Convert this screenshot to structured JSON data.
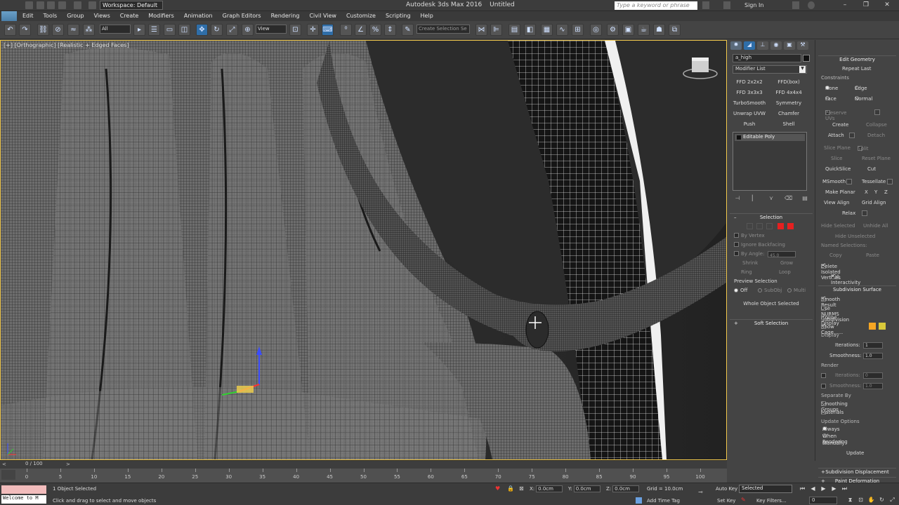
{
  "titlebar": {
    "workspace": "Workspace: Default",
    "app_name": "Autodesk 3ds Max 2016",
    "file_name": "Untitled",
    "search_placeholder": "Type a keyword or phrase",
    "sign_in": "Sign In"
  },
  "logo": "MAX",
  "menus": [
    "Edit",
    "Tools",
    "Group",
    "Views",
    "Create",
    "Modifiers",
    "Animation",
    "Graph Editors",
    "Rendering",
    "Civil View",
    "Customize",
    "Scripting",
    "Help"
  ],
  "toolbar": {
    "filter_value": "All",
    "ref_coord": "View",
    "named_selection_placeholder": "Create Selection Se"
  },
  "viewport": {
    "label_plus": "[+]",
    "label_view": "[Orthographic]",
    "label_shading": "[Realistic + Edged Faces]"
  },
  "command_panel": {
    "object_name": "a_high",
    "modifier_list": "Modifier List",
    "modifier_buttons": [
      "FFD 2x2x2",
      "FFD(box)",
      "FFD 3x3x3",
      "FFD 4x4x4",
      "TurboSmooth",
      "Symmetry",
      "Unwrap UVW",
      "Chamfer",
      "Push",
      "Shell"
    ],
    "stack_item": "Editable Poly",
    "selection": {
      "title": "Selection",
      "by_vertex": "By Vertex",
      "ignore_backfacing": "Ignore Backfacing",
      "by_angle": "By Angle:",
      "angle_value": "45.0",
      "shrink": "Shrink",
      "grow": "Grow",
      "ring": "Ring",
      "loop": "Loop",
      "preview_selection": "Preview Selection",
      "off": "Off",
      "subobj": "SubObj",
      "multi": "Multi",
      "whole_object": "Whole Object Selected"
    },
    "soft_selection": "Soft Selection"
  },
  "edit_geometry": {
    "title": "Edit Geometry",
    "repeat_last": "Repeat Last",
    "constraints": "Constraints",
    "none": "None",
    "edge": "Edge",
    "face": "Face",
    "normal": "Normal",
    "preserve_uvs": "Preserve UVs",
    "create": "Create",
    "collapse": "Collapse",
    "attach": "Attach",
    "detach": "Detach",
    "slice_plane": "Slice Plane",
    "split": "Split",
    "slice": "Slice",
    "reset_plane": "Reset Plane",
    "quickslice": "QuickSlice",
    "cut": "Cut",
    "msmooth": "MSmooth",
    "tessellate": "Tessellate",
    "make_planar": "Make Planar",
    "x": "X",
    "y": "Y",
    "z": "Z",
    "view_align": "View Align",
    "grid_align": "Grid Align",
    "relax": "Relax",
    "hide_selected": "Hide Selected",
    "unhide_all": "Unhide All",
    "hide_unselected": "Hide Unselected",
    "named_selections": "Named Selections:",
    "copy": "Copy",
    "paste": "Paste",
    "delete_isolated": "Delete Isolated Vertices",
    "full_interactivity": "Full Interactivity",
    "subdivision_surface": "Subdivision Surface",
    "smooth_result": "Smooth Result",
    "use_nurms": "Use NURMS Subdivision",
    "isoline_display": "Isoline Display",
    "show_cage": "Show Cage......",
    "display": "Display",
    "iterations": "Iterations:",
    "iterations_value": "1",
    "smoothness": "Smoothness:",
    "smoothness_value": "1.0",
    "render": "Render",
    "render_iterations_value": "0",
    "render_smoothness_value": "1.0",
    "separate_by": "Separate By",
    "smoothing_groups": "Smoothing Groups",
    "materials": "Materials",
    "update_options": "Update Options",
    "always": "Always",
    "when_rendering": "When Rendering",
    "manually": "Manually",
    "update": "Update",
    "subdivision_displacement": "Subdivision Displacement",
    "paint_deformation": "Paint Deformation",
    "cage_color_1": "#f5a623",
    "cage_color_2": "#d9c93a"
  },
  "timeline": {
    "frame_indicator": "0 / 100",
    "ticks": [
      "0",
      "5",
      "10",
      "15",
      "20",
      "25",
      "30",
      "35",
      "40",
      "45",
      "50",
      "55",
      "60",
      "65",
      "70",
      "75",
      "80",
      "85",
      "90",
      "95",
      "100"
    ]
  },
  "status": {
    "welcome": "Welcome to M",
    "selected": "1 Object Selected",
    "prompt": "Click and drag to select and move objects",
    "x_label": "X:",
    "x_value": "0.0cm",
    "y_label": "Y:",
    "y_value": "0.0cm",
    "z_label": "Z:",
    "z_value": "0.0cm",
    "grid": "Grid = 10.0cm",
    "add_time_tag": "Add Time Tag",
    "auto_key": "Auto Key",
    "set_key": "Set Key",
    "selection_set": "Selected",
    "key_filters": "Key Filters...",
    "current_frame": "0"
  }
}
